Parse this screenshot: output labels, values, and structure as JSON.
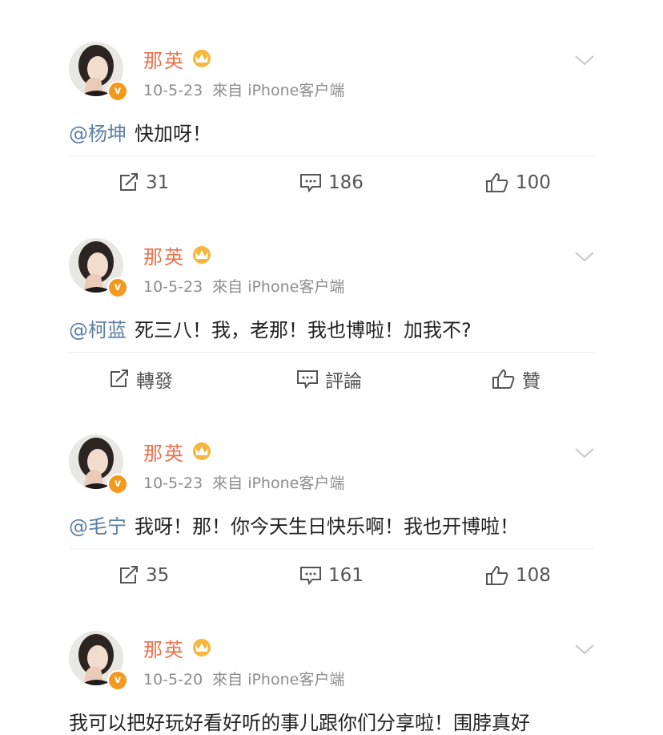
{
  "posts": [
    {
      "author": "那英",
      "date": "10-5-23",
      "source": "來自 iPhone客户端",
      "mention": "@杨坤",
      "text": "快加呀！",
      "repost": "31",
      "comment": "186",
      "like": "100"
    },
    {
      "author": "那英",
      "date": "10-5-23",
      "source": "來自 iPhone客户端",
      "mention": "@柯蓝",
      "text": "死三八！我，老那！我也博啦！加我不?",
      "repost": "轉發",
      "comment": "評論",
      "like": "贊"
    },
    {
      "author": "那英",
      "date": "10-5-23",
      "source": "來自 iPhone客户端",
      "mention": "@毛宁",
      "text": "我呀！那！你今天生日快乐啊！我也开博啦！",
      "repost": "35",
      "comment": "161",
      "like": "108"
    },
    {
      "author": "那英",
      "date": "10-5-20",
      "source": "來自 iPhone客户端",
      "mention": "",
      "text": "我可以把好玩好看好听的事儿跟你们分享啦！围脖真好",
      "repost": "",
      "comment": "",
      "like": ""
    }
  ],
  "verified_badge": "v",
  "icons": {
    "repost": "repost-icon",
    "comment": "comment-icon",
    "like": "like-icon",
    "chevron": "chevron-down-icon",
    "crown": "crown-badge-icon"
  },
  "colors": {
    "name": "#eb7350",
    "mention": "#5b7fa6",
    "meta": "#8d8d8d",
    "gap": "#ececec",
    "badge": "#f39a1e"
  }
}
